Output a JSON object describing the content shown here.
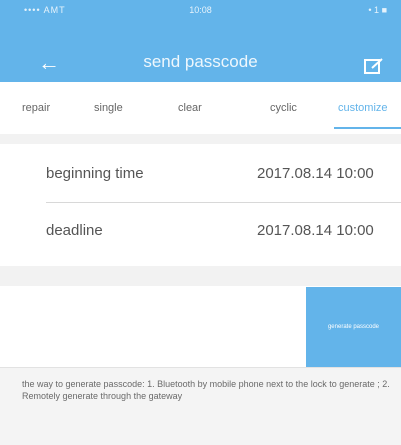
{
  "status_bar": {
    "carrier": "•••• AMT",
    "time": "10:08",
    "battery": "• 1 ■"
  },
  "header": {
    "title": "send passcode",
    "back_icon": "back-arrow-icon",
    "edit_icon": "edit-icon"
  },
  "tabs": [
    {
      "label": "repair",
      "active": false
    },
    {
      "label": "single",
      "active": false
    },
    {
      "label": "clear",
      "active": false
    },
    {
      "label": "cyclic",
      "active": false
    },
    {
      "label": "customize",
      "active": true
    }
  ],
  "form": {
    "beginning_time_label": "beginning time",
    "beginning_time_value": "2017.08.14 10:00",
    "deadline_label": "deadline",
    "deadline_value": "2017.08.14 10:00"
  },
  "generate_button_label": "generate passcode",
  "help_text": "the way to generate passcode: 1. Bluetooth by mobile phone next to the lock to generate ; 2. Remotely generate through the gateway",
  "colors": {
    "accent": "#63b4ea",
    "text": "#555555",
    "background": "#f2f2f2"
  }
}
